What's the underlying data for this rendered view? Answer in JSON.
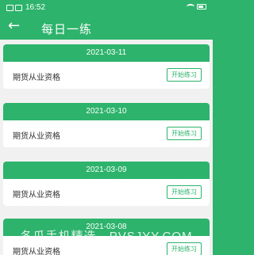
{
  "status_bar": {
    "time": "16:52",
    "icons": [
      "notification-icon",
      "notification-icon",
      "wifi-icon",
      "battery-icon"
    ]
  },
  "header": {
    "title": "每日一练",
    "back_icon": "←"
  },
  "cards": [
    {
      "date": "2021-03-11",
      "label": "期货从业资格",
      "button": "开始练习"
    },
    {
      "date": "2021-03-10",
      "label": "期货从业资格",
      "button": "开始练习"
    },
    {
      "date": "2021-03-09",
      "label": "期货从业资格",
      "button": "开始练习"
    },
    {
      "date": "2021-03-08",
      "label": "期货从业资格",
      "button": "开始练习"
    }
  ],
  "watermark": "冬瓜手机精选 - PVSJYY.COM",
  "colors": {
    "accent": "#2db36b",
    "background": "#f1f1f1",
    "card": "#ffffff"
  }
}
